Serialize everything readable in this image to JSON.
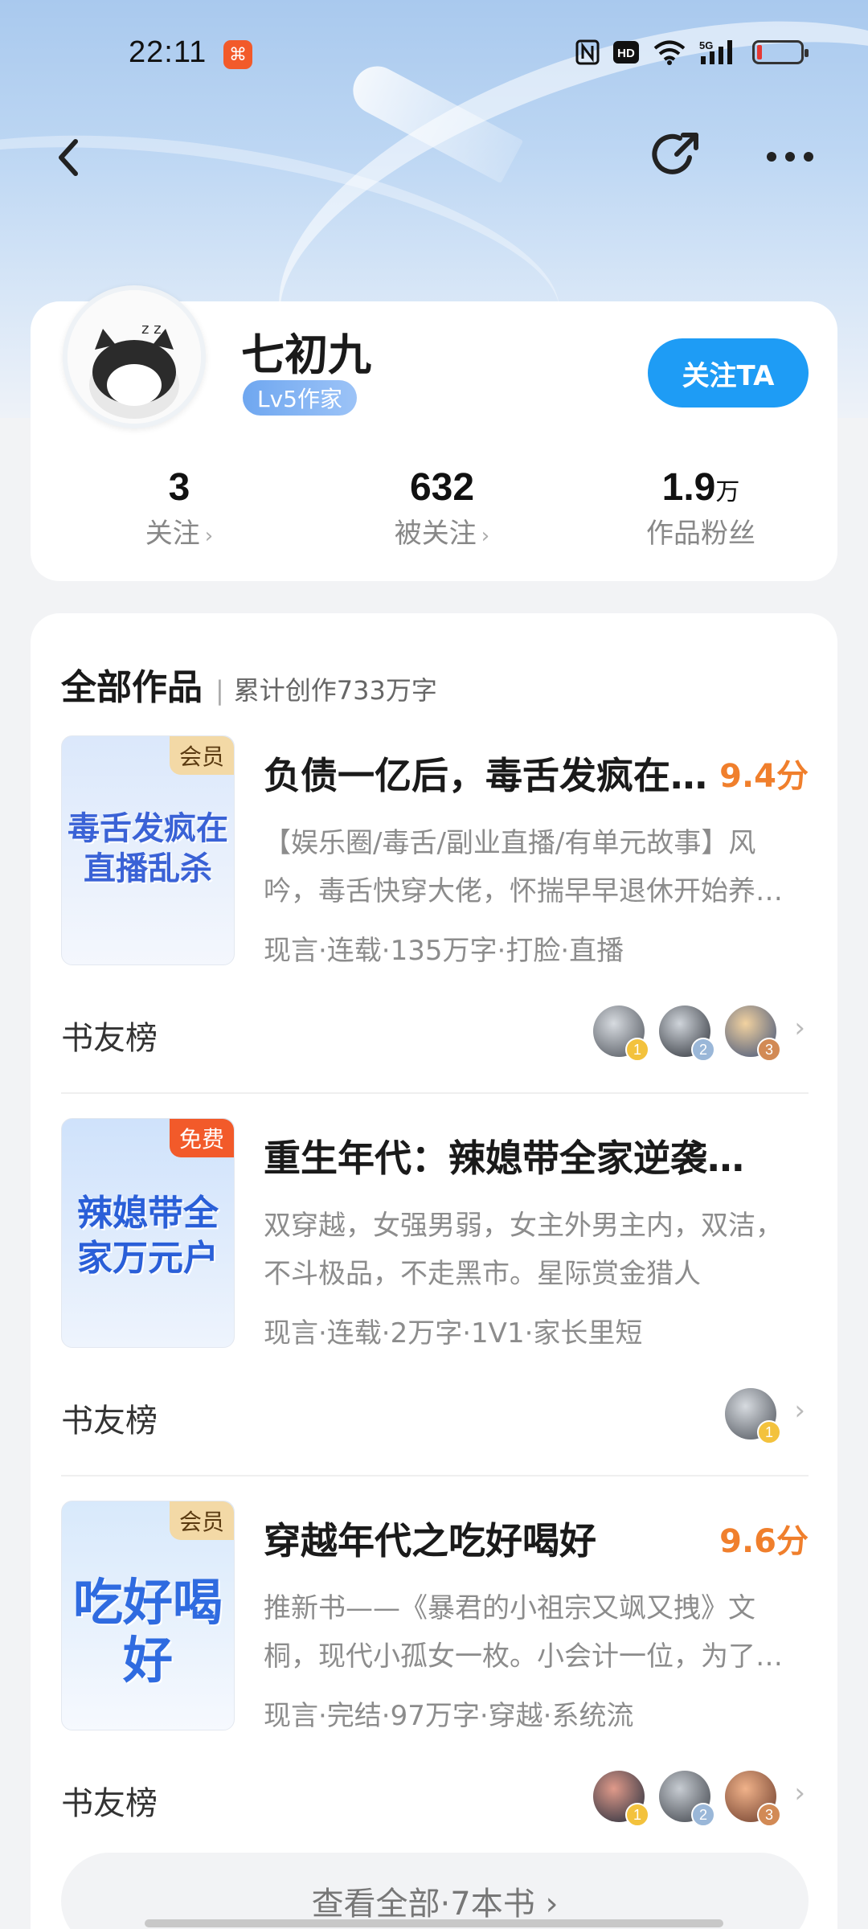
{
  "status_bar": {
    "time": "22:11",
    "app_badge": "⌘",
    "icons": [
      "nfc-icon",
      "hd-icon",
      "wifi-icon",
      "5g-signal-icon",
      "battery-icon"
    ],
    "hd_label": "HD",
    "signal_label": "5G"
  },
  "profile": {
    "name": "七初九",
    "level": "Lv5作家",
    "follow_button": "关注TA",
    "stats": [
      {
        "value": "3",
        "unit": "",
        "label": "关注"
      },
      {
        "value": "632",
        "unit": "",
        "label": "被关注"
      },
      {
        "value": "1.9",
        "unit": "万",
        "label": "作品粉丝"
      }
    ]
  },
  "works": {
    "title": "全部作品",
    "subtitle": "累计创作733万字",
    "books": [
      {
        "title": "负债一亿后，毒舌发疯在直播乱杀",
        "score": "9.4分",
        "tag": "会员",
        "cover_text": "毒舌发疯在直播乱杀",
        "desc": "【娱乐圈/毒舌/副业直播/有单元故事】风吟，毒舌快穿大佬，怀揣早早退休开始养老的梦想",
        "meta": "现言·连载·135万字·打脸·直播",
        "rank_label": "书友榜",
        "ranks": [
          "1",
          "2",
          "3"
        ]
      },
      {
        "title": "重生年代：辣媳带全家逆袭万元户",
        "score": "",
        "tag": "免费",
        "cover_text": "辣媳带全家万元户",
        "desc": "双穿越，女强男弱，女主外男主内，双洁，不斗极品，不走黑市。星际赏金猎人",
        "meta": "现言·连载·2万字·1V1·家长里短",
        "rank_label": "书友榜",
        "ranks": [
          "1"
        ]
      },
      {
        "title": "穿越年代之吃好喝好",
        "score": "9.6分",
        "tag": "会员",
        "cover_text": "吃好喝好",
        "desc": "推新书——《暴君的小祖宗又飒又拽》文桐，现代小孤女一枚。小会计一位，为了生活",
        "meta": "现言·完结·97万字·穿越·系统流",
        "rank_label": "书友榜",
        "ranks": [
          "1",
          "2",
          "3"
        ]
      }
    ],
    "view_all": "查看全部·7本书 ›"
  },
  "colors": {
    "accent": "#1e9cf5",
    "score": "#f07f2c",
    "vip_tag": "#f3d9a6",
    "free_tag": "#f25a2a"
  }
}
